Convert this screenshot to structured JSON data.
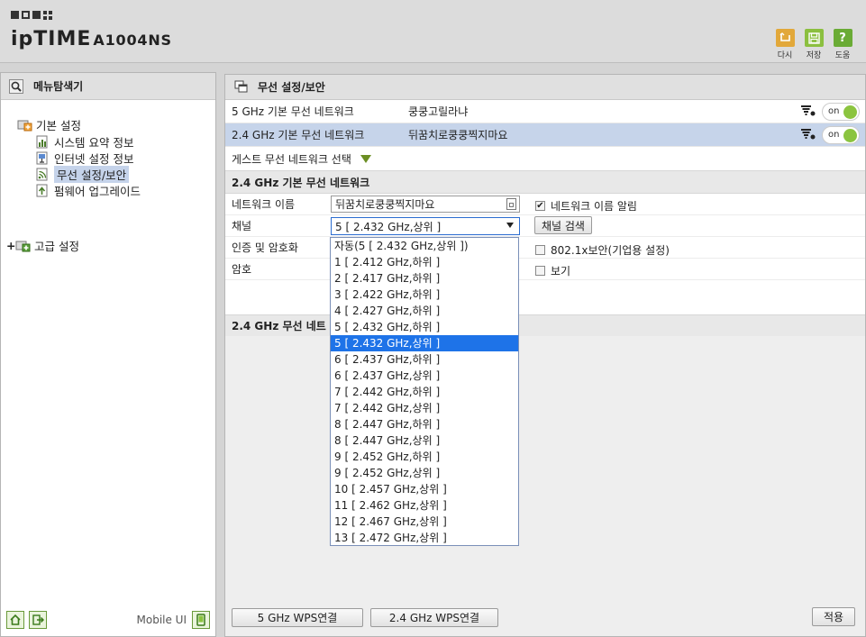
{
  "header": {
    "brand": "ipTIME",
    "model": "A1004NS",
    "buttons": [
      {
        "label": "다시",
        "icon": "undo-icon",
        "color": "#e2a83a"
      },
      {
        "label": "저장",
        "icon": "save-icon",
        "color": "#8bbf3f"
      },
      {
        "label": "도움",
        "icon": "help-icon",
        "color": "#6aab35"
      }
    ]
  },
  "left": {
    "title": "메뉴탐색기",
    "tree": {
      "basic": "기본 설정",
      "items": [
        "시스템 요약 정보",
        "인터넷 설정 정보",
        "무선 설정/보안",
        "펌웨어 업그레이드"
      ],
      "selected_index": 2,
      "advanced": "고급 설정",
      "expand_symbol": "+"
    },
    "footer": {
      "mobile_label": "Mobile UI"
    }
  },
  "main": {
    "title": "무선 설정/보안",
    "networks": [
      {
        "name": "5 GHz 기본 무선 네트워크",
        "ssid": "쿵쿵고릴라냐",
        "toggle": "on"
      },
      {
        "name": "2.4 GHz 기본 무선 네트워크",
        "ssid": "뒤꿈치로쿵쿵찍지마요",
        "toggle": "on"
      }
    ],
    "guest_label": "게스트 무선 네트워크 선택",
    "section_title": "2.4 GHz 기본 무선 네트워크",
    "form": {
      "network_name_label": "네트워크 이름",
      "network_name_value": "뒤꿈치로쿵쿵찍지마요",
      "broadcast_label": "네트워크 이름 알림",
      "channel_label": "채널",
      "channel_value": "5 [ 2.432 GHz,상위 ]",
      "channel_search": "채널 검색",
      "auth_label": "인증 및 암호화",
      "enterprise_label": "802.1x보안(기업용 설정)",
      "password_label": "암호",
      "show_label": "보기"
    },
    "section2_title": "2.4 GHz 무선 네트",
    "channel_options": [
      "자동(5 [ 2.432 GHz,상위 ])",
      "1 [ 2.412 GHz,하위 ]",
      "2 [ 2.417 GHz,하위 ]",
      "3 [ 2.422 GHz,하위 ]",
      "4 [ 2.427 GHz,하위 ]",
      "5 [ 2.432 GHz,하위 ]",
      "5 [ 2.432 GHz,상위 ]",
      "6 [ 2.437 GHz,하위 ]",
      "6 [ 2.437 GHz,상위 ]",
      "7 [ 2.442 GHz,하위 ]",
      "7 [ 2.442 GHz,상위 ]",
      "8 [ 2.447 GHz,하위 ]",
      "8 [ 2.447 GHz,상위 ]",
      "9 [ 2.452 GHz,하위 ]",
      "9 [ 2.452 GHz,상위 ]",
      "10 [ 2.457 GHz,상위 ]",
      "11 [ 2.462 GHz,상위 ]",
      "12 [ 2.467 GHz,상위 ]",
      "13 [ 2.472 GHz,상위 ]"
    ],
    "channel_selected_index": 6,
    "bottom": {
      "wps5": "5 GHz WPS연결",
      "wps24": "2.4 GHz WPS연결",
      "apply": "적용"
    }
  }
}
